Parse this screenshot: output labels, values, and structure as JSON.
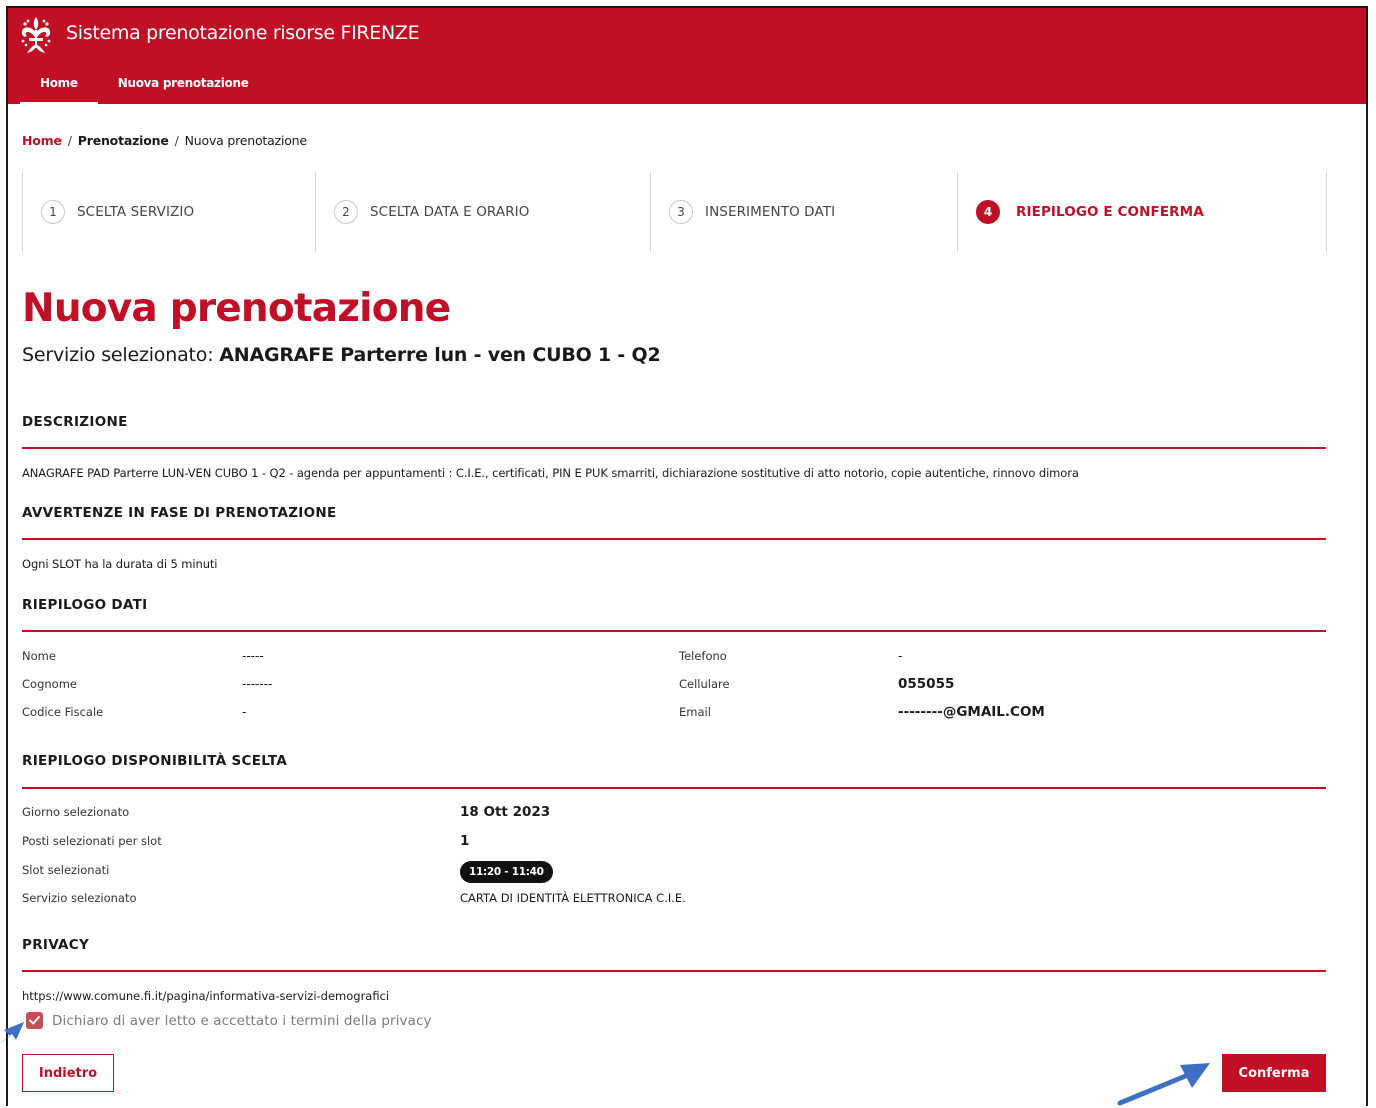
{
  "header": {
    "app_title": "Sistema prenotazione risorse FIRENZE",
    "nav": [
      "Home",
      "Nuova prenotazione"
    ]
  },
  "breadcrumb": {
    "home": "Home",
    "sep": "/",
    "prenotazione": "Prenotazione",
    "current": "Nuova prenotazione"
  },
  "steps": [
    {
      "num": "1",
      "label": "SCELTA SERVIZIO"
    },
    {
      "num": "2",
      "label": "SCELTA DATA E ORARIO"
    },
    {
      "num": "3",
      "label": "INSERIMENTO DATI"
    },
    {
      "num": "4",
      "label": "RIEPILOGO E CONFERMA",
      "active": true
    }
  ],
  "page": {
    "title": "Nuova prenotazione",
    "service_prefix": "Servizio selezionato:",
    "service_name": "ANAGRAFE Parterre lun - ven CUBO 1 - Q2"
  },
  "descrizione": {
    "heading": "DESCRIZIONE",
    "text": "ANAGRAFE PAD Parterre LUN-VEN CUBO 1 - Q2 - agenda per appuntamenti : C.I.E., certificati, PIN E PUK smarriti, dichiarazione sostitutive di atto notorio, copie autentiche, rinnovo dimora"
  },
  "avvertenze": {
    "heading": "AVVERTENZE IN FASE DI PRENOTAZIONE",
    "text": "Ogni SLOT ha la durata di 5 minuti"
  },
  "riepilogo_dati": {
    "heading": "RIEPILOGO DATI",
    "nome_label": "Nome",
    "nome_value": "-----",
    "cognome_label": "Cognome",
    "cognome_value": "-------",
    "cf_label": "Codice Fiscale",
    "cf_value": "-",
    "telefono_label": "Telefono",
    "telefono_value": "-",
    "cellulare_label": "Cellulare",
    "cellulare_value": "055055",
    "email_label": "Email",
    "email_value": "--------@GMAIL.COM"
  },
  "disponibilita": {
    "heading": "RIEPILOGO DISPONIBILITÀ SCELTA",
    "giorno_label": "Giorno selezionato",
    "giorno_value": "18 Ott 2023",
    "posti_label": "Posti selezionati per slot",
    "posti_value": "1",
    "slot_label": "Slot selezionati",
    "slot_value": "11:20 - 11:40",
    "servizio_label": "Servizio selezionato",
    "servizio_value": "CARTA DI IDENTITÀ ELETTRONICA C.I.E."
  },
  "privacy": {
    "heading": "PRIVACY",
    "url": "https://www.comune.fi.it/pagina/informativa-servizi-demografici",
    "checkbox_label": "Dichiaro di aver letto e accettato i termini della privacy",
    "checked": true
  },
  "actions": {
    "back": "Indietro",
    "confirm": "Conferma"
  },
  "colors": {
    "brand_red": "#c10f26",
    "annotation_arrow": "#3f6fc4"
  }
}
